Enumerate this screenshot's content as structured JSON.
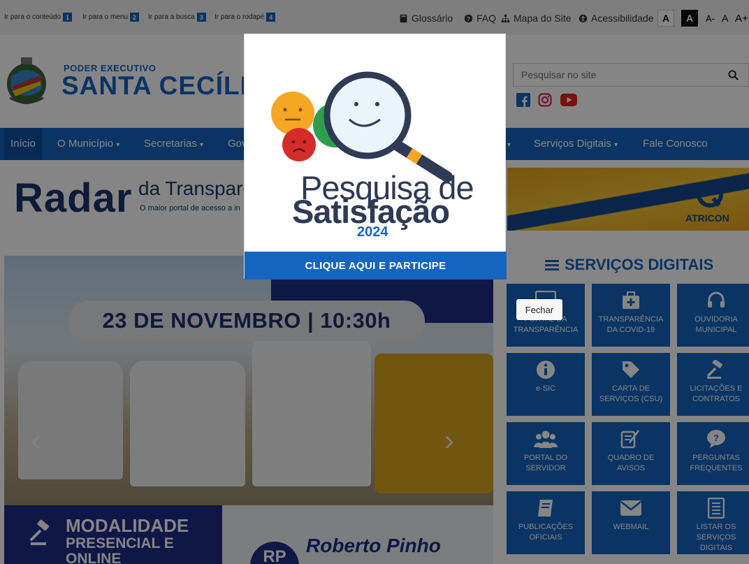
{
  "skip_links": [
    {
      "label": "Ir para o conteúdo",
      "key": "1"
    },
    {
      "label": "Ir para o menu",
      "key": "2"
    },
    {
      "label": "Ir para a busca",
      "key": "3"
    },
    {
      "label": "Ir para o rodapé",
      "key": "4"
    }
  ],
  "top_links": {
    "glossario": "Glossário",
    "faq": "FAQ",
    "mapa": "Mapa do Site",
    "acessibilidade": "Acessibilidade"
  },
  "font_controls": {
    "contrast_a": "A",
    "dark_a": "A",
    "decrease": "A-",
    "normal": "A",
    "increase": "A+"
  },
  "header": {
    "subtitle": "PODER EXECUTIVO",
    "title": "SANTA CECÍLIA",
    "search_placeholder": "Pesquisar no site"
  },
  "nav": {
    "items": [
      "Início",
      "O Município",
      "Secretarias",
      "Gov",
      "Serviços Digitais",
      "Fale Conosco"
    ]
  },
  "banner": {
    "radar": "Radar",
    "radar_da": "da Transparê",
    "radar_tagline": "O maior portal de acesso a in",
    "atricon": "ATRICON"
  },
  "carousel": {
    "date": "23 DE NOVEMBRO | 10:30h",
    "modalidade_title": "MODALIDADE",
    "modalidade_sub": "PRESENCIAL E ONLINE",
    "rp_badge": "RP",
    "rp_name": "Roberto Pinho"
  },
  "services": {
    "title": "SERVIÇOS DIGITAIS",
    "tiles": [
      {
        "label": "PORTAL DA TRANSPARÊNCIA",
        "icon": "monitor-icon"
      },
      {
        "label": "TRANSPARÊNCIA DA COVID-19",
        "icon": "medkit-icon"
      },
      {
        "label": "OUVIDORIA MUNICIPAL",
        "icon": "headset-icon"
      },
      {
        "label": "e-SIC",
        "icon": "info-icon"
      },
      {
        "label": "CARTA DE SERVIÇOS (CSU)",
        "icon": "tag-icon"
      },
      {
        "label": "LICITAÇÕES E CONTRATOS",
        "icon": "gavel-icon"
      },
      {
        "label": "PORTAL DO SERVIDOR",
        "icon": "users-icon"
      },
      {
        "label": "QUADRO DE AVISOS",
        "icon": "edit-icon"
      },
      {
        "label": "PERGUNTAS FREQUENTES",
        "icon": "chat-icon"
      },
      {
        "label": "PUBLICAÇÕES OFICIAIS",
        "icon": "book-icon"
      },
      {
        "label": "WEBMAIL",
        "icon": "envelope-icon"
      },
      {
        "label": "LISTAR OS SERVIÇOS DIGITAIS",
        "icon": "list-icon"
      }
    ]
  },
  "popup": {
    "line1": "Pesquisa de",
    "line2": "Satisfação",
    "year": "2024",
    "cta": "CLIQUE AQUI E PARTICIPE",
    "close": "Fechar"
  },
  "colors": {
    "primary": "#1565c0",
    "navy": "#1c2d87",
    "overlay": "rgba(0,0,0,0.48)"
  }
}
